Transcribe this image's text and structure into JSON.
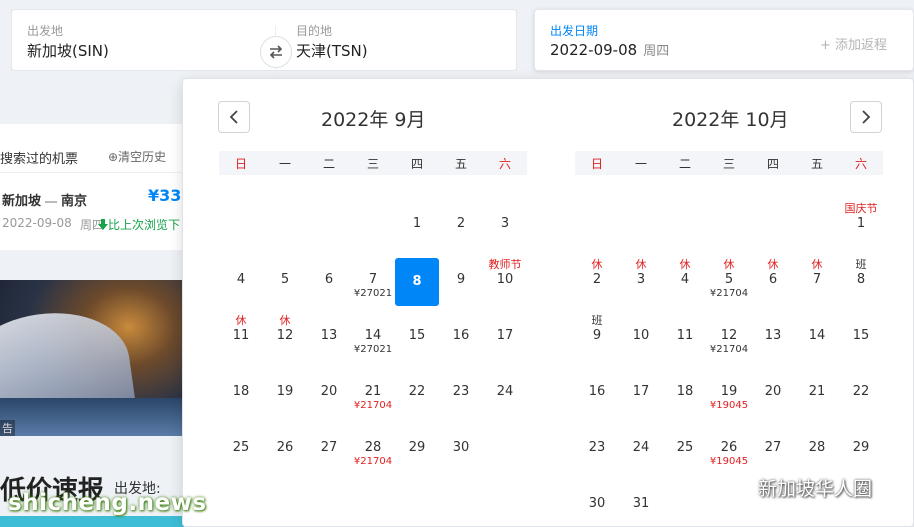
{
  "search": {
    "from_label": "出发地",
    "from_value": "新加坡(SIN)",
    "to_label": "目的地",
    "to_value": "天津(TSN)",
    "date_label": "出发日期",
    "date_value": "2022-09-08",
    "date_weekday": "周四",
    "add_return": "+ 添加返程"
  },
  "history": {
    "title": "搜索过的机票",
    "clear": "⊕清空历史",
    "route_from": "新加坡",
    "route_to": "南京",
    "price": "¥33",
    "date": "2022-09-08",
    "weekday": "周四",
    "compare": "比上次浏览下"
  },
  "promo": {
    "ad": "告",
    "title": "低价速报",
    "from_label": "出发地:"
  },
  "calendar": {
    "months": [
      {
        "title": "2022年 9月",
        "weekdays": [
          "日",
          "一",
          "二",
          "三",
          "四",
          "五",
          "六"
        ],
        "cells": [
          {
            "col": 4,
            "row": 0,
            "day": "1"
          },
          {
            "col": 5,
            "row": 0,
            "day": "2"
          },
          {
            "col": 6,
            "row": 0,
            "day": "3"
          },
          {
            "col": 0,
            "row": 1,
            "day": "4"
          },
          {
            "col": 1,
            "row": 1,
            "day": "5"
          },
          {
            "col": 2,
            "row": 1,
            "day": "6"
          },
          {
            "col": 3,
            "row": 1,
            "day": "7",
            "price": "¥27021"
          },
          {
            "col": 4,
            "row": 1,
            "day": "8",
            "selected": true
          },
          {
            "col": 5,
            "row": 1,
            "day": "9"
          },
          {
            "col": 6,
            "row": 1,
            "day": "10",
            "tag": "教师节"
          },
          {
            "col": 0,
            "row": 2,
            "day": "11",
            "tag": "休"
          },
          {
            "col": 1,
            "row": 2,
            "day": "12",
            "tag": "休"
          },
          {
            "col": 2,
            "row": 2,
            "day": "13"
          },
          {
            "col": 3,
            "row": 2,
            "day": "14",
            "price": "¥27021"
          },
          {
            "col": 4,
            "row": 2,
            "day": "15"
          },
          {
            "col": 5,
            "row": 2,
            "day": "16"
          },
          {
            "col": 6,
            "row": 2,
            "day": "17"
          },
          {
            "col": 0,
            "row": 3,
            "day": "18"
          },
          {
            "col": 1,
            "row": 3,
            "day": "19"
          },
          {
            "col": 2,
            "row": 3,
            "day": "20"
          },
          {
            "col": 3,
            "row": 3,
            "day": "21",
            "price": "¥21704",
            "price_red": true
          },
          {
            "col": 4,
            "row": 3,
            "day": "22"
          },
          {
            "col": 5,
            "row": 3,
            "day": "23"
          },
          {
            "col": 6,
            "row": 3,
            "day": "24"
          },
          {
            "col": 0,
            "row": 4,
            "day": "25"
          },
          {
            "col": 1,
            "row": 4,
            "day": "26"
          },
          {
            "col": 2,
            "row": 4,
            "day": "27"
          },
          {
            "col": 3,
            "row": 4,
            "day": "28",
            "price": "¥21704",
            "price_red": true
          },
          {
            "col": 4,
            "row": 4,
            "day": "29"
          },
          {
            "col": 5,
            "row": 4,
            "day": "30"
          }
        ]
      },
      {
        "title": "2022年 10月",
        "weekdays": [
          "日",
          "一",
          "二",
          "三",
          "四",
          "五",
          "六"
        ],
        "cells": [
          {
            "col": 6,
            "row": 0,
            "day": "1",
            "tag": "国庆节"
          },
          {
            "col": 0,
            "row": 1,
            "day": "2",
            "tag": "休"
          },
          {
            "col": 1,
            "row": 1,
            "day": "3",
            "tag": "休"
          },
          {
            "col": 2,
            "row": 1,
            "day": "4",
            "tag": "休"
          },
          {
            "col": 3,
            "row": 1,
            "day": "5",
            "tag": "休",
            "price": "¥21704"
          },
          {
            "col": 4,
            "row": 1,
            "day": "6",
            "tag": "休"
          },
          {
            "col": 5,
            "row": 1,
            "day": "7",
            "tag": "休"
          },
          {
            "col": 6,
            "row": 1,
            "day": "8",
            "tag": "班",
            "work": true
          },
          {
            "col": 0,
            "row": 2,
            "day": "9",
            "tag": "班",
            "work": true
          },
          {
            "col": 1,
            "row": 2,
            "day": "10"
          },
          {
            "col": 2,
            "row": 2,
            "day": "11"
          },
          {
            "col": 3,
            "row": 2,
            "day": "12",
            "price": "¥21704"
          },
          {
            "col": 4,
            "row": 2,
            "day": "13"
          },
          {
            "col": 5,
            "row": 2,
            "day": "14"
          },
          {
            "col": 6,
            "row": 2,
            "day": "15"
          },
          {
            "col": 0,
            "row": 3,
            "day": "16"
          },
          {
            "col": 1,
            "row": 3,
            "day": "17"
          },
          {
            "col": 2,
            "row": 3,
            "day": "18"
          },
          {
            "col": 3,
            "row": 3,
            "day": "19",
            "price": "¥19045",
            "price_red": true
          },
          {
            "col": 4,
            "row": 3,
            "day": "20"
          },
          {
            "col": 5,
            "row": 3,
            "day": "21"
          },
          {
            "col": 6,
            "row": 3,
            "day": "22"
          },
          {
            "col": 0,
            "row": 4,
            "day": "23"
          },
          {
            "col": 1,
            "row": 4,
            "day": "24"
          },
          {
            "col": 2,
            "row": 4,
            "day": "25"
          },
          {
            "col": 3,
            "row": 4,
            "day": "26",
            "price": "¥19045",
            "price_red": true
          },
          {
            "col": 4,
            "row": 4,
            "day": "27"
          },
          {
            "col": 5,
            "row": 4,
            "day": "28"
          },
          {
            "col": 6,
            "row": 4,
            "day": "29"
          },
          {
            "col": 0,
            "row": 5,
            "day": "30"
          },
          {
            "col": 1,
            "row": 5,
            "day": "31"
          }
        ]
      }
    ]
  },
  "watermarks": {
    "left": "shicheng.news",
    "right": "新加坡华人圈"
  },
  "colors": {
    "accent": "#0086f6",
    "holiday_red": "#e02020"
  }
}
